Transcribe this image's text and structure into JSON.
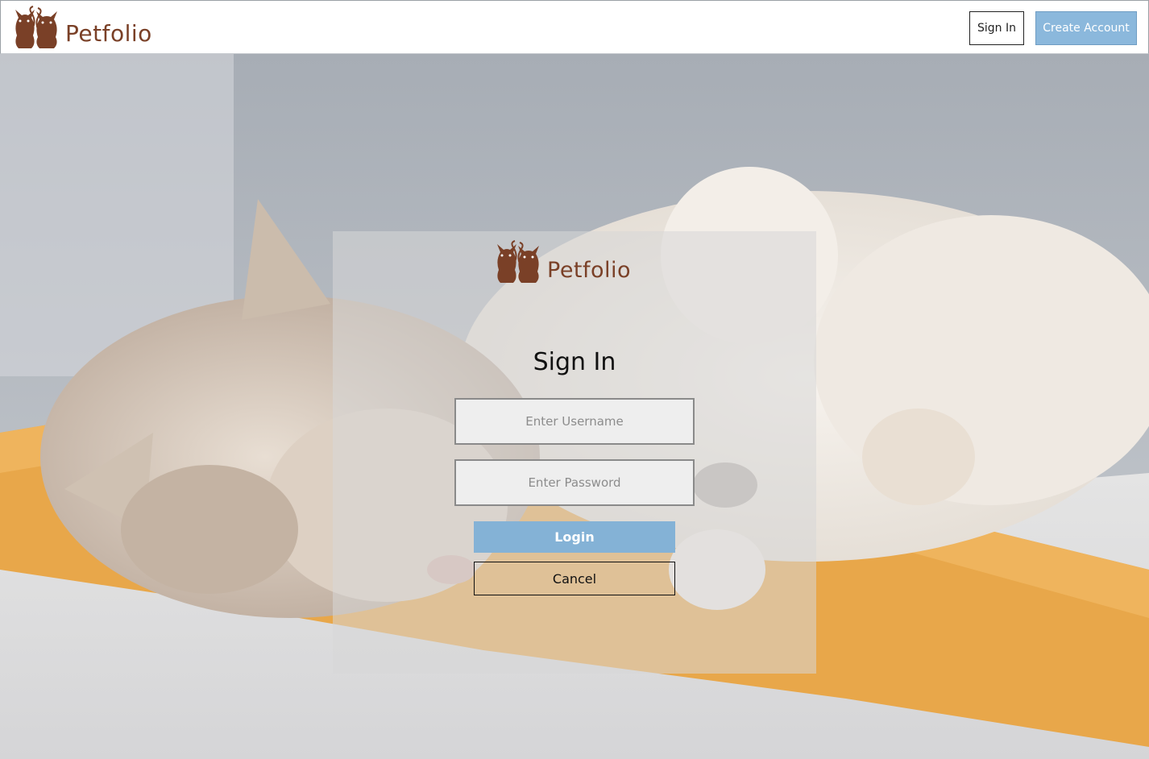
{
  "brand": {
    "name": "Petfolio",
    "logo_icon": "two-cats-icon",
    "color": "#7a4027"
  },
  "navbar": {
    "sign_in_label": "Sign In",
    "create_account_label": "Create Account",
    "accent": "#8bb8dc"
  },
  "hero": {
    "image": "sleeping-kitten-and-puppy-photo"
  },
  "login": {
    "title": "Sign In",
    "username_placeholder": "Enter Username",
    "password_placeholder": "Enter Password",
    "login_label": "Login",
    "cancel_label": "Cancel"
  }
}
